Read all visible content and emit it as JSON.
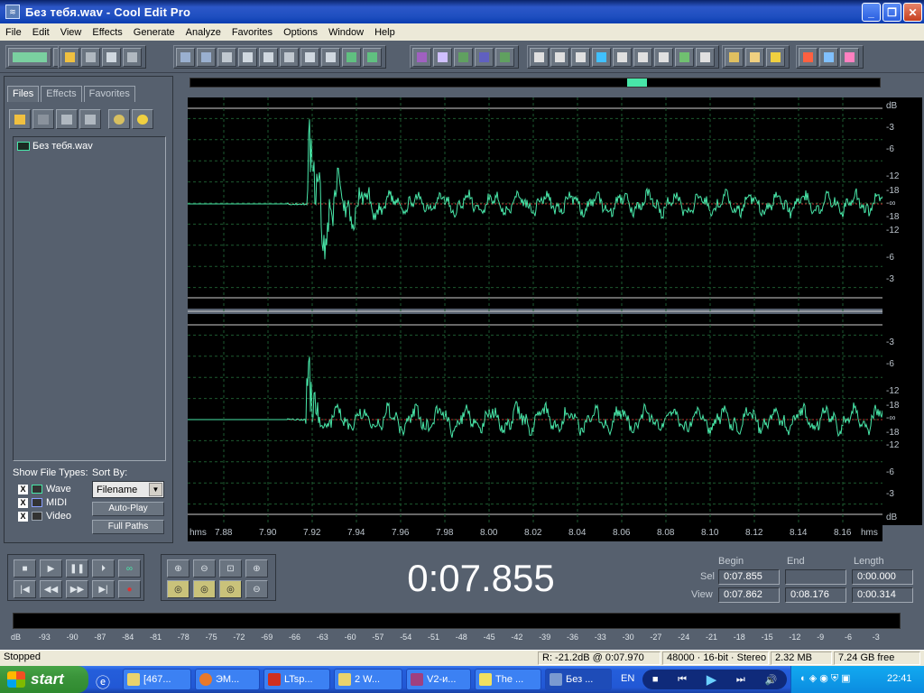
{
  "window": {
    "title": "Без тебя.wav - Cool Edit Pro",
    "minimize": "_",
    "maximize": "❐",
    "close": "✕"
  },
  "menu": [
    "File",
    "Edit",
    "View",
    "Effects",
    "Generate",
    "Analyze",
    "Favorites",
    "Options",
    "Window",
    "Help"
  ],
  "toolbar_icons": [
    "multitrack-toggle-icon",
    "new-icon",
    "open-icon",
    "close-file-icon",
    "save-icon",
    "save-all-icon",
    "undo-icon",
    "redo-icon",
    "repeat-icon",
    "copy-icon",
    "copy-new-icon",
    "cut-icon",
    "paste-icon",
    "paste-new-icon",
    "mix-paste-icon",
    "trim-icon",
    "envelope-icon",
    "fade-icon",
    "normalize-icon",
    "noise-icon",
    "spectral-icon",
    "waveform-view-icon",
    "spectral-view-icon",
    "snap-icon",
    "cue-icon",
    "play-list-icon",
    "time-format-icon",
    "frames-icon",
    "rulers-icon",
    "grid-icon",
    "settings-icon",
    "scripts-icon",
    "help-icon",
    "analysis-icon",
    "frequency-icon",
    "phase-icon"
  ],
  "organizer": {
    "tabs": [
      "Files",
      "Effects",
      "Favorites"
    ],
    "active_tab": "Files",
    "files": [
      "Без тебя.wav"
    ],
    "show_file_types_label": "Show File Types:",
    "file_types": [
      {
        "label": "Wave",
        "checked": "X"
      },
      {
        "label": "MIDI",
        "checked": "X"
      },
      {
        "label": "Video",
        "checked": "X"
      }
    ],
    "sort_by_label": "Sort By:",
    "sort_value": "Filename",
    "auto_play": "Auto-Play",
    "full_paths": "Full Paths"
  },
  "db_scale_top": [
    "dB",
    "-3",
    "-6",
    "-12",
    "-18",
    "-∞",
    "-18",
    "-12",
    "-6",
    "-3"
  ],
  "db_scale_bottom": [
    "-3",
    "-6",
    "-12",
    "-18",
    "-∞",
    "-18",
    "-12",
    "-6",
    "-3",
    "dB"
  ],
  "time_axis": {
    "unit": "hms",
    "ticks": [
      "7.88",
      "7.90",
      "7.92",
      "7.94",
      "7.96",
      "7.98",
      "8.00",
      "8.02",
      "8.04",
      "8.06",
      "8.08",
      "8.10",
      "8.12",
      "8.14",
      "8.16"
    ],
    "unit_end": "hms"
  },
  "current_time": "0:07.855",
  "selection": {
    "headers": [
      "Begin",
      "End",
      "Length"
    ],
    "sel_label": "Sel",
    "view_label": "View",
    "sel": [
      "0:07.855",
      "",
      "0:00.000"
    ],
    "view": [
      "0:07.862",
      "0:08.176",
      "0:00.314"
    ]
  },
  "level_meter": [
    "dB",
    "-93",
    "-90",
    "-87",
    "-84",
    "-81",
    "-78",
    "-75",
    "-72",
    "-69",
    "-66",
    "-63",
    "-60",
    "-57",
    "-54",
    "-51",
    "-48",
    "-45",
    "-42",
    "-39",
    "-36",
    "-33",
    "-30",
    "-27",
    "-24",
    "-21",
    "-18",
    "-15",
    "-12",
    "-9",
    "-6",
    "-3"
  ],
  "status": {
    "state": "Stopped",
    "cursor": "R: -21.2dB @  0:07.970",
    "format": "48000 · 16-bit · Stereo",
    "size": "2.32 MB",
    "free": "7.24 GB free"
  },
  "taskbar": {
    "start": "start",
    "tasks": [
      "[467...",
      "ЭМ...",
      "LTsp...",
      "2 W...",
      "V2-и...",
      "The ...",
      "Без ..."
    ],
    "lang": "EN",
    "clock": "22:41"
  },
  "colors": {
    "wave": "#48e6a8",
    "grid": "#1d5a2f",
    "bg": "#000000",
    "center": "#c03030"
  }
}
